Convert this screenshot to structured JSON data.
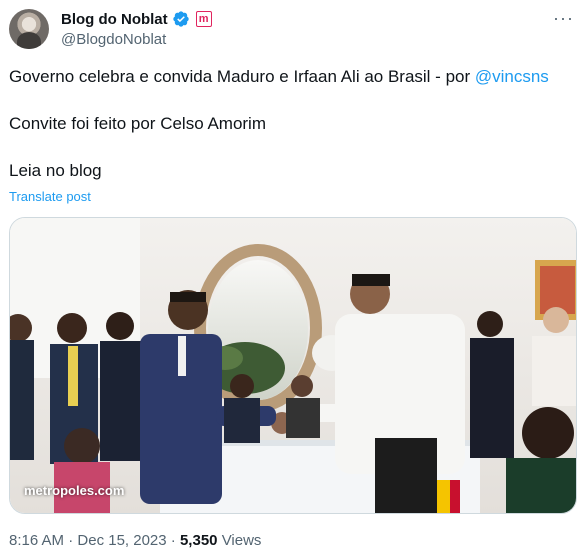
{
  "post": {
    "author_name": "Blog do Noblat",
    "handle": "@BlogdoNoblat",
    "badge_letter": "m",
    "text_line1": "Governo celebra e convida Maduro e Irfaan Ali ao Brasil - por ",
    "mention": "@vincsns",
    "text_line2": "Convite foi feito por Celso Amorim",
    "text_line3": "Leia no blog",
    "translate_label": "Translate post",
    "image_watermark": "metropoles.com",
    "time": "8:16 AM",
    "separator": " · ",
    "date": "Dec 15, 2023",
    "views_count": "5,350",
    "views_label": "Views"
  },
  "icons": {
    "verified": "verified-badge-icon",
    "brand": "metropoles-badge-icon",
    "more": "more-options-icon"
  },
  "colors": {
    "accent": "#1d9bf0",
    "text": "#0f1419",
    "secondary": "#536471",
    "brand_badge": "#e0245e"
  }
}
